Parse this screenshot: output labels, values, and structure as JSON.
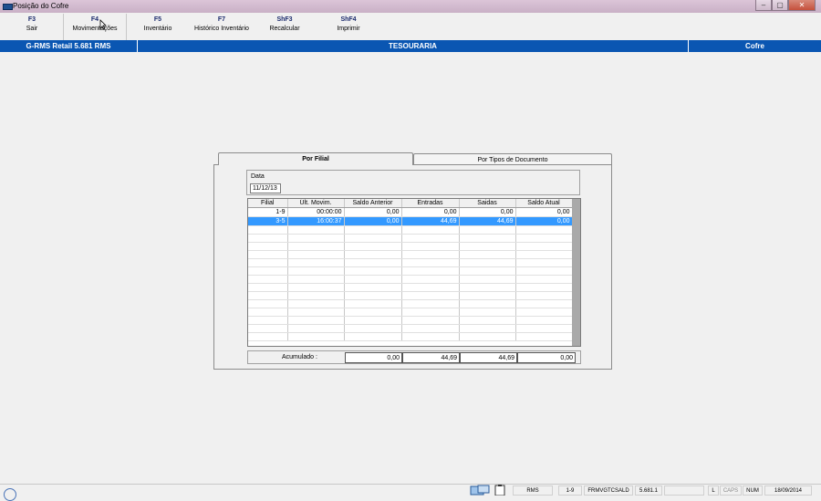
{
  "window": {
    "title": "Posição do Cofre",
    "buttons": [
      "‒",
      "▢",
      "✕"
    ]
  },
  "toolbar": {
    "keys": [
      {
        "key": "F3",
        "label": "Sair"
      },
      {
        "key": "F4",
        "label": "Movimentações"
      },
      {
        "key": "F5",
        "label": "Inventário"
      },
      {
        "key": "F7",
        "label": "Histórico Inventário"
      },
      {
        "key": "ShF3",
        "label": "Recalcular"
      },
      {
        "key": "ShF4",
        "label": "Imprimir"
      }
    ]
  },
  "header": {
    "left": "G-RMS Retail 5.681 RMS",
    "center": "TESOURARIA",
    "right": "Cofre"
  },
  "tabs": [
    {
      "label": "Por Filial",
      "active": true
    },
    {
      "label": "Por Tipos de Documento",
      "active": false
    }
  ],
  "date": {
    "label": "Data",
    "value": "11/12/13"
  },
  "table": {
    "columns": [
      "Filial",
      "Últ. Movim.",
      "Saldo Anterior",
      "Entradas",
      "Saidas",
      "Saldo Atual"
    ],
    "rows": [
      [
        "1-9",
        "00:00:00",
        "0,00",
        "0,00",
        "0,00",
        "0,00"
      ],
      [
        "3-5",
        "16:00:37",
        "0,00",
        "44,69",
        "44,69",
        "0,00"
      ]
    ],
    "selected_row": 1
  },
  "accumulated": {
    "label": "Acumulado :",
    "values": [
      "0,00",
      "44,69",
      "44,69",
      "0,00"
    ]
  },
  "statusbar": {
    "fields": [
      "RMS",
      "1-9",
      "FRMVGTCSALD",
      "5.681.1",
      "",
      "L",
      "CAPS",
      "NUM",
      "18/09/2014"
    ]
  },
  "colors": {
    "header_bg": "#0a56b2",
    "selection": "#3399ff",
    "titlebar": "#dcc5d8"
  }
}
